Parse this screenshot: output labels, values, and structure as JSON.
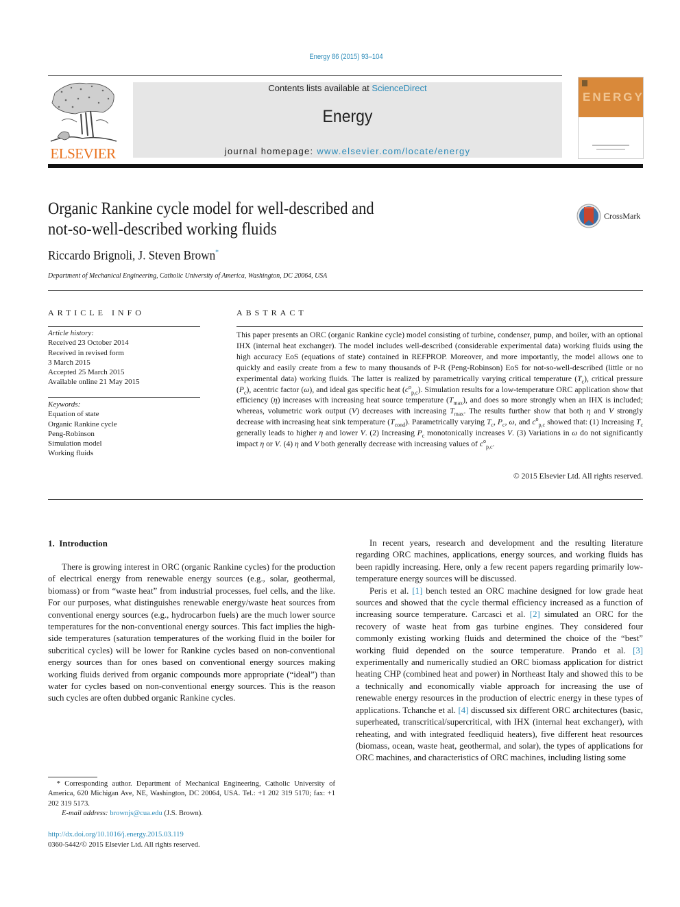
{
  "header": {
    "citation": "Energy 86 (2015) 93–104",
    "contents_prefix": "Contents lists available at ",
    "contents_link": "ScienceDirect",
    "journal_name": "Energy",
    "homepage_prefix": "journal homepage: ",
    "homepage_link": "www.elsevier.com/locate/energy",
    "publisher_logo_text": "ELSEVIER",
    "cover_title": "ENERGY",
    "brand_color": "#e9711c",
    "link_color": "#2a8ab8"
  },
  "article": {
    "title_line1": "Organic Rankine cycle model for well-described and",
    "title_line2": "not-so-well-described working fluids",
    "crossmark_label": "CrossMark",
    "authors": "Riccardo Brignoli, J. Steven Brown",
    "author_marker": "*",
    "affiliation": "Department of Mechanical Engineering, Catholic University of America, Washington, DC 20064, USA"
  },
  "article_info": {
    "heading": "ARTICLE INFO",
    "history_label": "Article history:",
    "history": [
      "Received 23 October 2014",
      "Received in revised form",
      "3 March 2015",
      "Accepted 25 March 2015",
      "Available online 21 May 2015"
    ],
    "keywords_label": "Keywords:",
    "keywords": [
      "Equation of state",
      "Organic Rankine cycle",
      "Peng-Robinson",
      "Simulation model",
      "Working fluids"
    ]
  },
  "abstract": {
    "heading": "ABSTRACT",
    "s1": "This paper presents an ORC (organic Rankine cycle) model consisting of turbine, condenser, pump, and boiler, with an optional IHX (internal heat exchanger). The model includes well-described (considerable experimental data) working fluids using the high accuracy EoS (equations of state) contained in REFPROP. Moreover, and more importantly, the model allows one to quickly and easily create from a few to many thousands of P-R (Peng-Robinson) EoS for not-so-well-described (little or no experimental data) working fluids. The latter is realized by parametrically varying critical temperature (",
    "s2": "), critical pressure (",
    "s3": "), acentric factor (",
    "s4": "), and ideal gas specific heat (",
    "s5": "). Simulation results for a low-temperature ORC application show that efficiency (",
    "s6": ") increases with increasing heat source temperature (",
    "s7": "), and does so more strongly when an IHX is included; whereas, volumetric work output (",
    "s8": ") decreases with increasing ",
    "s9": ". The results further show that both ",
    "s10": " and ",
    "s11": " strongly decrease with increasing heat sink temperature (",
    "s12": "). Parametrically varying ",
    "s13": ", ",
    "s14": ", ",
    "s15": ", and ",
    "s16": " showed that: (1) Increasing ",
    "s17": " generally leads to higher ",
    "s18": " and lower ",
    "s19": ". (2) Increasing ",
    "s20": " monotonically increases ",
    "s21": ". (3) Variations in ",
    "s22": " do not significantly impact ",
    "s23": " or ",
    "s24": ". (4) ",
    "s25": " and ",
    "s26": " both generally decrease with increasing values of ",
    "s27": ".",
    "sym_T": "T",
    "sym_P": "P",
    "sub_c": "c",
    "sym_omega": "ω",
    "sym_cp": "c",
    "sup_o": "o",
    "sub_pc": "p,c",
    "sym_eta": "η",
    "sub_max": "max",
    "sym_V": "V",
    "sub_cond": "cond",
    "copyright": "© 2015 Elsevier Ltd. All rights reserved."
  },
  "body": {
    "section_number": "1.",
    "section_title": "Introduction",
    "left_p1": "There is growing interest in ORC (organic Rankine cycles) for the production of electrical energy from renewable energy sources (e.g., solar, geothermal, biomass) or from “waste heat” from industrial processes, fuel cells, and the like. For our purposes, what distinguishes renewable energy/waste heat sources from conventional energy sources (e.g., hydrocarbon fuels) are the much lower source temperatures for the non-conventional energy sources. This fact implies the high-side temperatures (saturation temperatures of the working fluid in the boiler for subcritical cycles) will be lower for Rankine cycles based on non-conventional energy sources than for ones based on conventional energy sources making working fluids derived from organic compounds more appropriate (“ideal”) than water for cycles based on non-conventional energy sources. This is the reason such cycles are often dubbed organic Rankine cycles.",
    "right_p1": "In recent years, research and development and the resulting literature regarding ORC machines, applications, energy sources, and working fluids has been rapidly increasing. Here, only a few recent papers regarding primarily low-temperature energy sources will be discussed.",
    "right_p2_a": "Peris et al. ",
    "ref1": "[1]",
    "right_p2_b": " bench tested an ORC machine designed for low grade heat sources and showed that the cycle thermal efficiency increased as a function of increasing source temperature. Carcasci et al. ",
    "ref2": "[2]",
    "right_p2_c": " simulated an ORC for the recovery of waste heat from gas turbine engines. They considered four commonly existing working fluids and determined the choice of the “best” working fluid depended on the source temperature. Prando et al. ",
    "ref3": "[3]",
    "right_p2_d": " experimentally and numerically studied an ORC biomass application for district heating CHP (combined heat and power) in Northeast Italy and showed this to be a technically and economically viable approach for increasing the use of renewable energy resources in the production of electric energy in these types of applications. Tchanche et al. ",
    "ref4": "[4]",
    "right_p2_e": " discussed six different ORC architectures (basic, superheated, transcritical/supercritical, with IHX (internal heat exchanger), with reheating, and with integrated feedliquid heaters), five different heat resources (biomass, ocean, waste heat, geothermal, and solar), the types of applications for ORC machines, and characteristics of ORC machines, including listing some"
  },
  "footnote": {
    "marker": "*",
    "text": " Corresponding author. Department of Mechanical Engineering, Catholic University of America, 620 Michigan Ave, NE, Washington, DC 20064, USA. Tel.: +1 202 319 5170; fax: +1 202 319 5173.",
    "email_label": "E-mail address: ",
    "email": "brownjs@cua.edu",
    "email_suffix": " (J.S. Brown).",
    "doi": "http://dx.doi.org/10.1016/j.energy.2015.03.119",
    "issn_line": "0360-5442/© 2015 Elsevier Ltd. All rights reserved."
  }
}
